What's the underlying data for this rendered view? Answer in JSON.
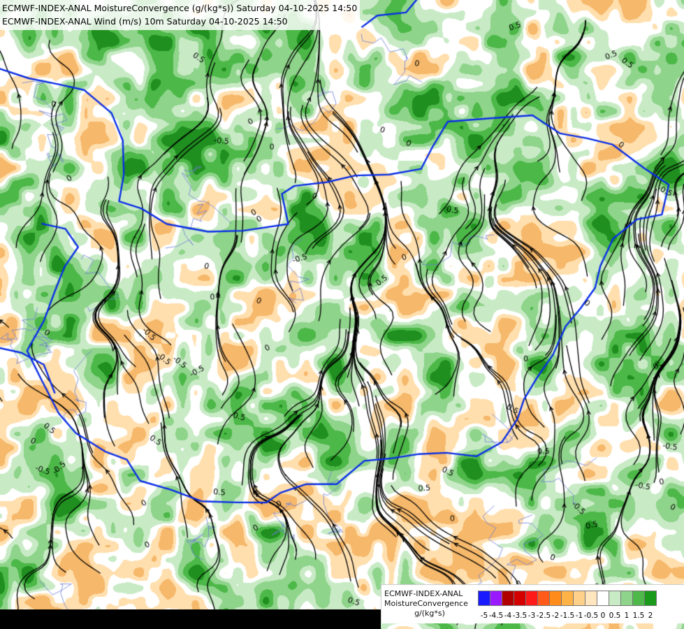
{
  "header": {
    "line1": "ECMWF-INDEX-ANAL MoistureConvergence (g/(kg*s)) Saturday 04-10-2025 14:50",
    "line2": "ECMWF-INDEX-ANAL Wind (m/s) 10m Saturday 04-10-2025 14:50"
  },
  "map": {
    "colors": {
      "border": "#0a2ee6",
      "river": "#6e7fd8",
      "streamline": "#000000",
      "contour_label": "#000000"
    },
    "contour_labels": [
      "0",
      "-0.5",
      "0.5"
    ]
  },
  "legend": {
    "line1": "ECMWF-INDEX-ANAL",
    "line2": "MoistureConvergence",
    "unit": "g/(kg*s)",
    "ticks": [
      "-5",
      "-4.5",
      "-4",
      "-3.5",
      "-3",
      "-2.5",
      "-2",
      "-1.5",
      "-1",
      "-0.5",
      "0",
      "0.5",
      "1",
      "1.5",
      "2"
    ],
    "colors": [
      "#1a1aff",
      "#9a1aff",
      "#b00000",
      "#d40000",
      "#ff1a1a",
      "#ff5a1a",
      "#ff8c1a",
      "#ffb347",
      "#ffd08a",
      "#ffe6bf",
      "#ffffff",
      "#c8ebc6",
      "#8fd48b",
      "#4fb84a",
      "#1a9a1a"
    ]
  }
}
